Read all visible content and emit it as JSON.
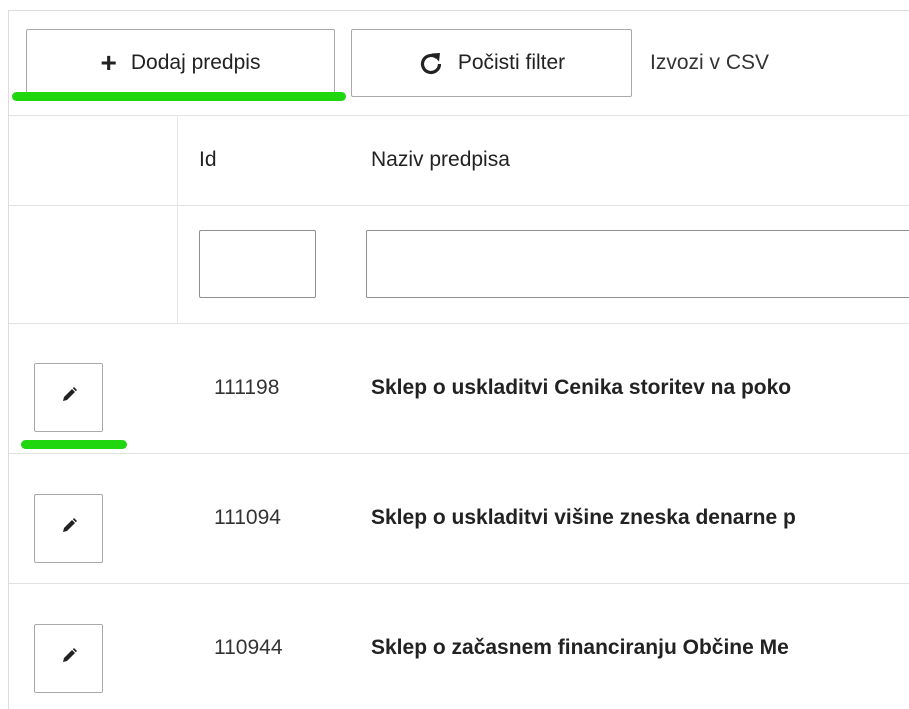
{
  "toolbar": {
    "add_label": "Dodaj predpis",
    "clear_filter_label": "Počisti filter",
    "export_label": "Izvozi v CSV"
  },
  "table": {
    "columns": [
      "",
      "Id",
      "Naziv predpisa"
    ],
    "filters": {
      "id_value": "",
      "name_value": ""
    },
    "rows": [
      {
        "id": "111198",
        "name": "Sklep o uskladitvi Cenika storitev na poko"
      },
      {
        "id": "111094",
        "name": "Sklep o uskladitvi višine zneska denarne p"
      },
      {
        "id": "110944",
        "name": "Sklep o začasnem financiranju Občine Me"
      }
    ]
  },
  "highlight_color": "#1fd60f",
  "icons": {
    "add": "plus-icon",
    "clear": "refresh-icon",
    "edit": "pencil-icon"
  }
}
